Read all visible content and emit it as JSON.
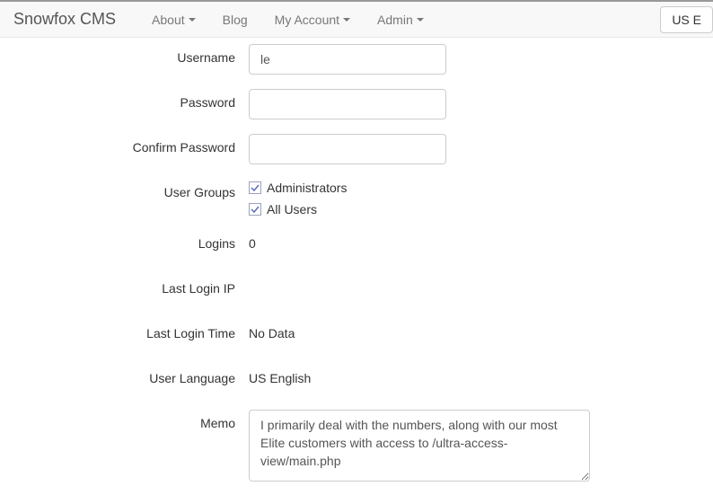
{
  "navbar": {
    "brand": "Snowfox CMS",
    "items": [
      {
        "label": "About",
        "dropdown": true
      },
      {
        "label": "Blog",
        "dropdown": false
      },
      {
        "label": "My Account",
        "dropdown": true
      },
      {
        "label": "Admin",
        "dropdown": true
      }
    ],
    "lang_button": "US E"
  },
  "form": {
    "username": {
      "label": "Username",
      "value": "le"
    },
    "password": {
      "label": "Password",
      "value": ""
    },
    "confirm_password": {
      "label": "Confirm Password",
      "value": ""
    },
    "user_groups": {
      "label": "User Groups",
      "options": [
        {
          "label": "Administrators",
          "checked": true
        },
        {
          "label": "All Users",
          "checked": true
        }
      ]
    },
    "logins": {
      "label": "Logins",
      "value": "0"
    },
    "last_login_ip": {
      "label": "Last Login IP",
      "value": ""
    },
    "last_login_time": {
      "label": "Last Login Time",
      "value": "No Data"
    },
    "user_language": {
      "label": "User Language",
      "value": "US English"
    },
    "memo": {
      "label": "Memo",
      "value": "I primarily deal with the numbers, along with our most Elite customers with access to /ultra-access-view/main.php"
    }
  }
}
